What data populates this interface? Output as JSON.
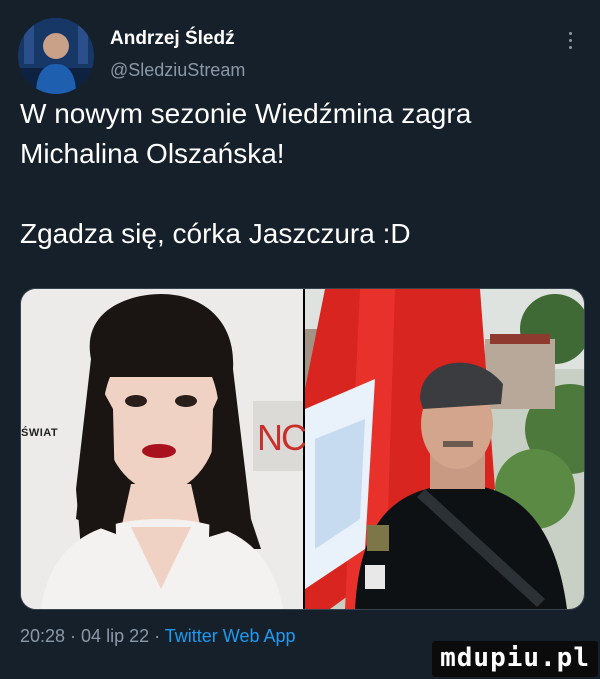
{
  "author": {
    "display_name": "Andrzej Śledź",
    "handle": "@SledziuStream",
    "avatar_icon": "profile-avatar-icon"
  },
  "more_icon": "more-vertical-icon",
  "tweet": {
    "lines": [
      "W nowym sezonie Wiedźmina zagra",
      "Michalina Olszańska!",
      "Zgadza się, córka Jaszczura :D"
    ]
  },
  "media": {
    "left_label": "ŚWIAT",
    "right_label": "NCI"
  },
  "meta": {
    "time": "20:28",
    "separator": " · ",
    "date": "04 lip 22",
    "source": "Twitter Web App"
  },
  "watermark": {
    "text": "mdupiu.pl"
  },
  "colors": {
    "background": "#15202b",
    "text_primary": "#ffffff",
    "text_secondary": "#8b98a5",
    "link": "#1d9bf0"
  }
}
